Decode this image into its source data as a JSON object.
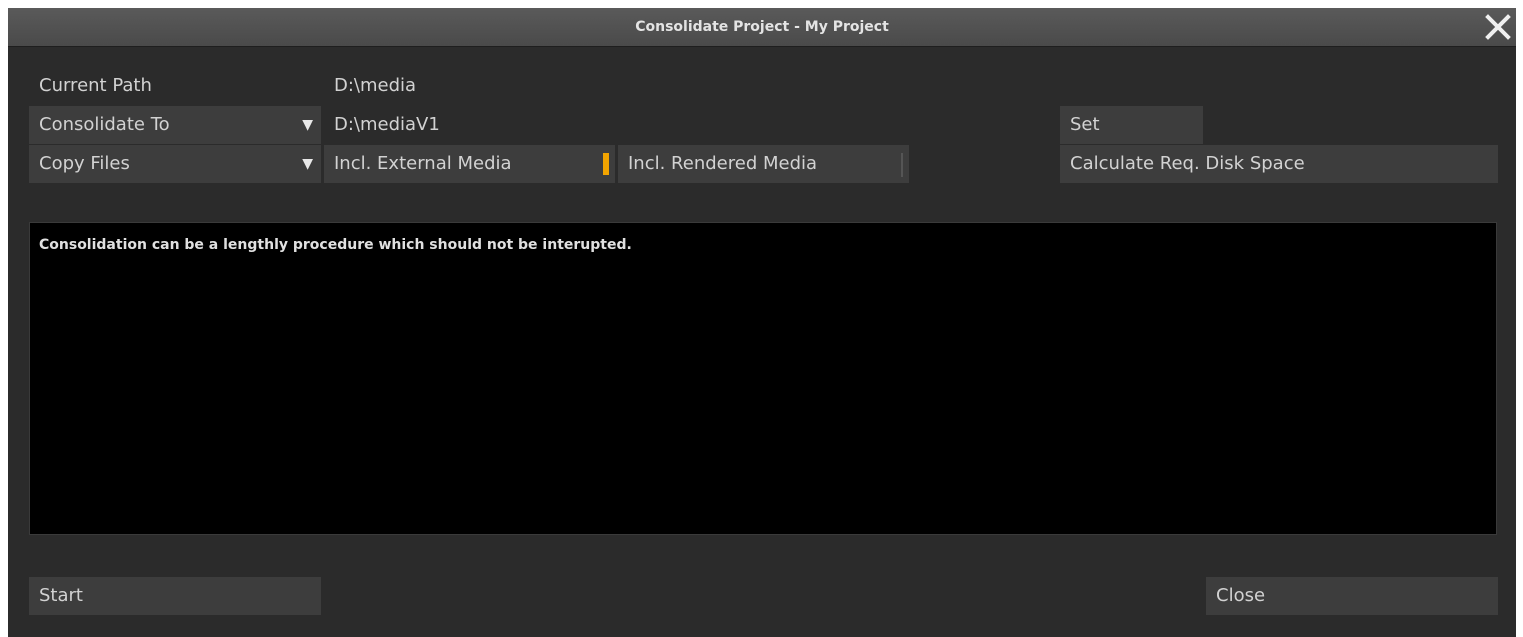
{
  "window": {
    "title": "Consolidate Project - My Project"
  },
  "rows": {
    "current_path_label": "Current Path",
    "current_path_value": "D:\\media",
    "consolidate_to_label": "Consolidate To",
    "consolidate_to_value": "D:\\mediaV1",
    "set_label": "Set",
    "copy_mode_label": "Copy Files",
    "incl_external_label": "Incl. External Media",
    "incl_external_checked": true,
    "incl_rendered_label": "Incl. Rendered Media",
    "incl_rendered_checked": false,
    "calculate_label": "Calculate Req. Disk Space"
  },
  "console": {
    "message": "Consolidation can be a lengthly procedure which should not be interupted."
  },
  "footer": {
    "start_label": "Start",
    "close_label": "Close"
  },
  "icons": {
    "close": "close-icon",
    "dropdown": "caret-down-icon"
  },
  "colors": {
    "accent_checked": "#f2a400",
    "window_bg": "#2b2b2b",
    "console_bg": "#000000"
  }
}
